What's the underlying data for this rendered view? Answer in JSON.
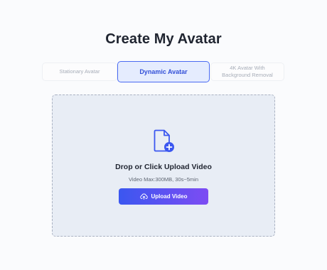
{
  "page": {
    "title": "Create My Avatar"
  },
  "tabs": [
    {
      "label": "Stationary Avatar",
      "active": false
    },
    {
      "label": "Dynamic Avatar",
      "active": true
    },
    {
      "label": "4K Avatar With Background Removal",
      "active": false
    }
  ],
  "dropzone": {
    "title": "Drop or Click Upload Video",
    "subtitle": "Video Max:300MB, 30s~5min",
    "button_label": "Upload Video",
    "icon": "file-add-icon",
    "button_icon": "cloud-upload-icon"
  },
  "colors": {
    "accent": "#4a6af2",
    "button_start": "#3b57f0",
    "button_end": "#7d4cf3",
    "dropzone_bg": "#e8edf5",
    "title_text": "#1f2430"
  }
}
